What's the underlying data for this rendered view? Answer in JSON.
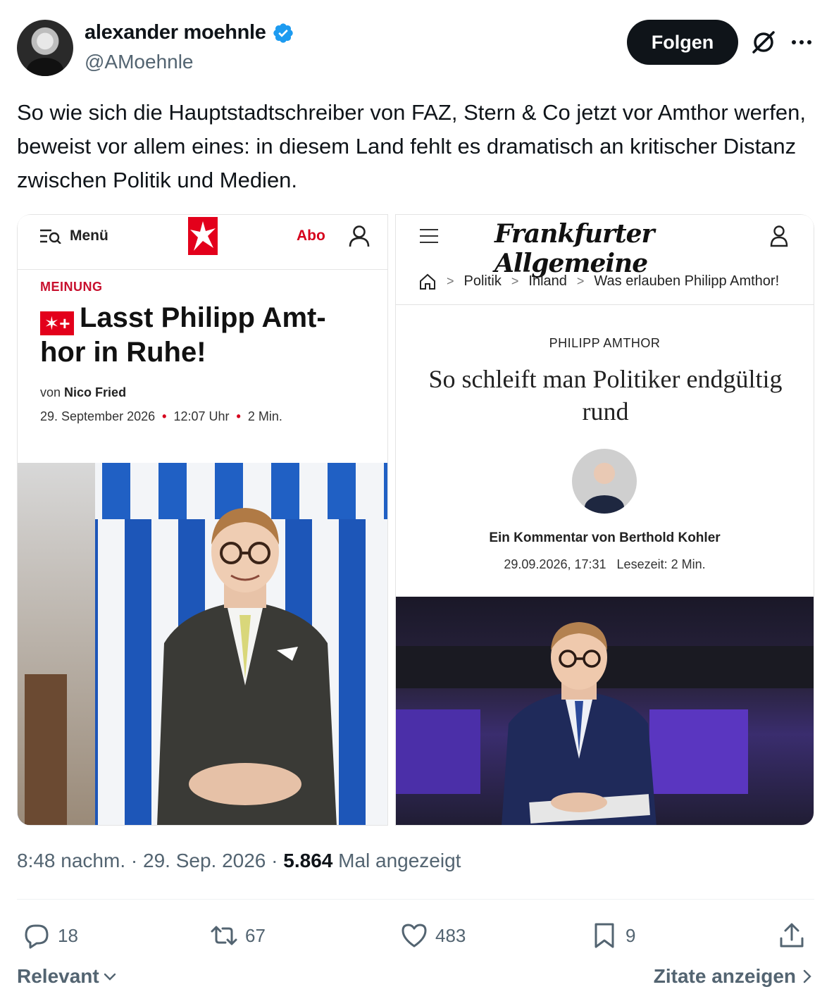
{
  "author": {
    "name": "alexander moehnle",
    "handle": "@AMoehnle",
    "verified": true
  },
  "header": {
    "follow_label": "Folgen"
  },
  "tweet": {
    "text": "So wie sich die Hauptstadtschreiber von FAZ, Stern & Co jetzt vor Amthor werfen, beweist vor allem eines: in diesem Land fehlt es dramatisch an kritischer Distanz zwischen Politik und Medien."
  },
  "media": {
    "stern": {
      "menu_label": "Menü",
      "abo_label": "Abo",
      "kicker": "MEINUNG",
      "plus_badge": "✶+",
      "title": "Lasst Philipp Amt-hor in Ruhe!",
      "byline_prefix": "von",
      "author": "Nico Fried",
      "date": "29. September 2026",
      "time": "12:07 Uhr",
      "read_time": "2 Min.",
      "brand_color": "#e3001b"
    },
    "faz": {
      "logo_text": "Frankfurter Allgemeine",
      "breadcrumb": [
        "Politik",
        "Inland",
        "Was erlauben Philipp Amthor!"
      ],
      "kicker": "PHILIPP AMTHOR",
      "title": "So schleift man Politiker endgültig rund",
      "byline": "Ein Kommentar von Berthold Kohler",
      "date": "29.09.2026, 17:31",
      "read_time": "Lesezeit: 2 Min."
    }
  },
  "meta": {
    "time": "8:48 nachm.",
    "date": "29. Sep. 2026",
    "views_count": "5.864",
    "views_label": "Mal angezeigt"
  },
  "actions": {
    "replies": "18",
    "reposts": "67",
    "likes": "483",
    "bookmarks": "9"
  },
  "footer": {
    "sort_label": "Relevant",
    "quotes_label": "Zitate anzeigen"
  },
  "colors": {
    "text_primary": "#0f1419",
    "text_secondary": "#536471",
    "verified_blue": "#1d9bf0"
  }
}
